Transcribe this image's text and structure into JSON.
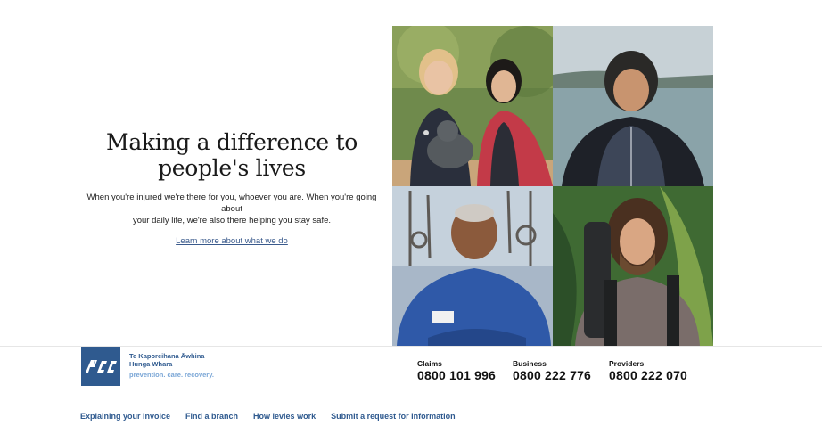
{
  "hero": {
    "title_line1": "Making a difference to",
    "title_line2": "people's lives",
    "desc_line1": "When you're injured we're there for you, whoever you are. When you're going about",
    "desc_line2": "your daily life, we're also there helping you stay safe.",
    "link": "Learn more about what we do"
  },
  "brand": {
    "logo_text": "ACC",
    "name_line1": "Te Kaporeihana Āwhina",
    "name_line2": "Hunga Whara",
    "tagline": "prevention. care. recovery.",
    "color": "#2f5a8f"
  },
  "contacts": [
    {
      "label": "Claims",
      "number": "0800 101 996"
    },
    {
      "label": "Business",
      "number": "0800 222 776"
    },
    {
      "label": "Providers",
      "number": "0800 222 070"
    }
  ],
  "footer_links": [
    "Explaining your invoice",
    "Find a branch",
    "How levies work",
    "Submit a request for information"
  ]
}
